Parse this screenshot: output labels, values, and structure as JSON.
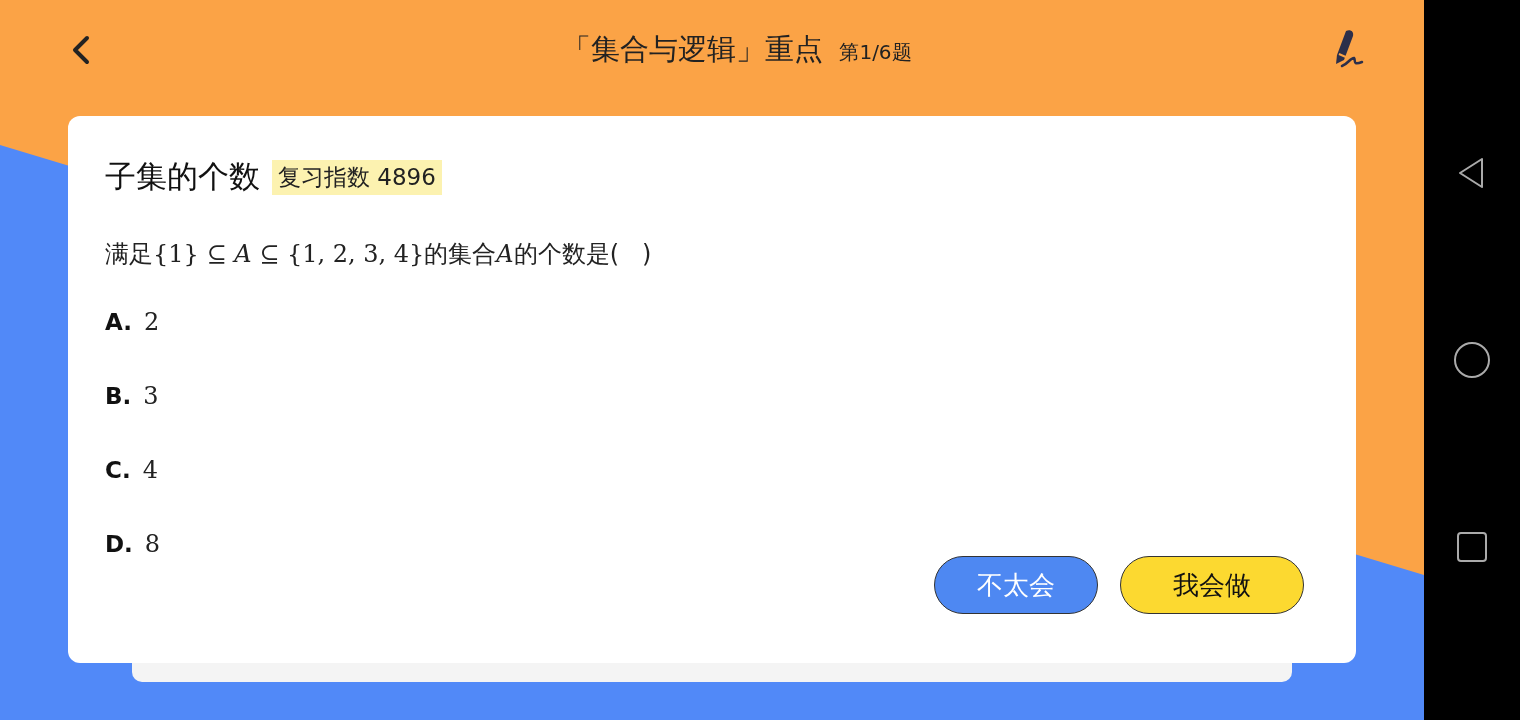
{
  "header": {
    "title": "「集合与逻辑」重点",
    "progress": "第1/6题"
  },
  "card": {
    "title": "子集的个数",
    "badge": "复习指数 4896",
    "question": [
      {
        "kind": "text",
        "text": "满足"
      },
      {
        "kind": "math",
        "text": "{1} ⊆ "
      },
      {
        "kind": "var",
        "text": "A"
      },
      {
        "kind": "math",
        "text": " ⊆ {1, 2, 3, 4}"
      },
      {
        "kind": "text",
        "text": "的集合"
      },
      {
        "kind": "var",
        "text": "A"
      },
      {
        "kind": "text",
        "text": "的个数是(   )"
      }
    ],
    "options": [
      {
        "letter": "A.",
        "value": "2"
      },
      {
        "letter": "B.",
        "value": "3"
      },
      {
        "letter": "C.",
        "value": "4"
      },
      {
        "letter": "D.",
        "value": "8"
      }
    ],
    "buttons": [
      {
        "label": "不太会",
        "kind": "secondary"
      },
      {
        "label": "我会做",
        "kind": "primary"
      }
    ]
  }
}
